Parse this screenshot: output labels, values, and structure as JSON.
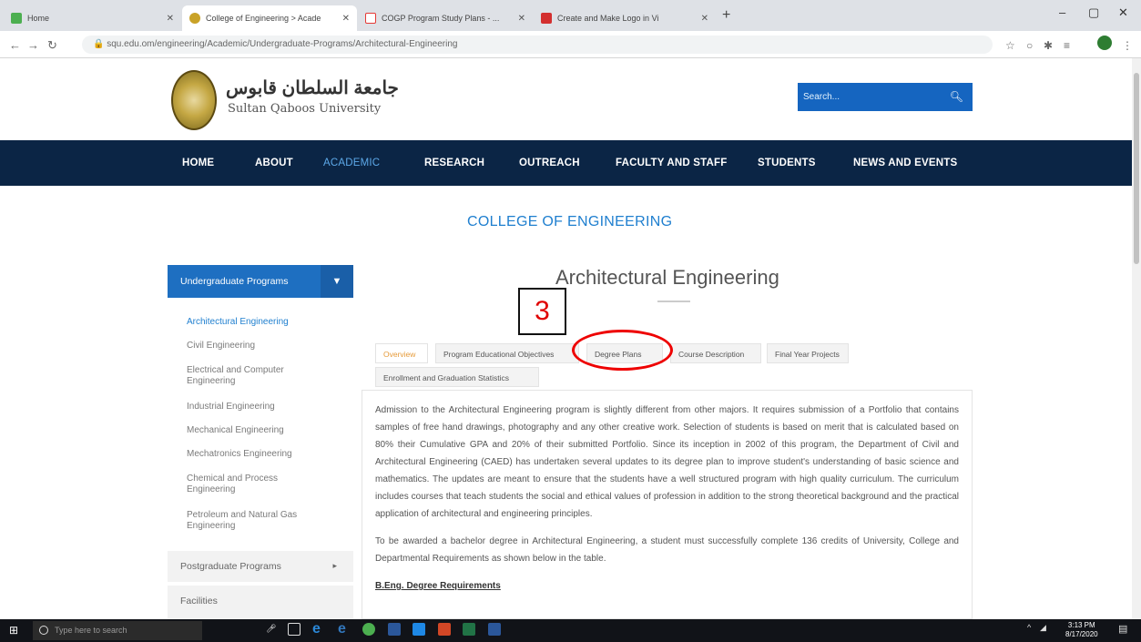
{
  "browser": {
    "tabs": [
      {
        "label": "Home",
        "active": false,
        "color": "#4caf50"
      },
      {
        "label": "College of Engineering > Acade",
        "active": true,
        "color": "#c9a227"
      },
      {
        "label": "COGP Program Study Plans - ...",
        "active": false,
        "color": "#e53935"
      },
      {
        "label": "Create and Make Logo in Vi",
        "active": false,
        "color": "#d32f2f"
      }
    ],
    "new_tab": "+",
    "url": "squ.edu.om/engineering/Academic/Undergraduate-Programs/Architectural-Engineering",
    "window_controls": [
      "–",
      "▢",
      "✕"
    ]
  },
  "site": {
    "logo_arabic": "جامعة السلطان قابوس",
    "logo_english": "Sultan Qaboos University",
    "search_placeholder": "Search...",
    "nav": [
      {
        "label": "HOME",
        "active": false
      },
      {
        "label": "ABOUT",
        "active": false
      },
      {
        "label": "ACADEMIC",
        "active": true
      },
      {
        "label": "RESEARCH",
        "active": false
      },
      {
        "label": "OUTREACH",
        "active": false
      },
      {
        "label": "FACULTY AND STAFF",
        "active": false
      },
      {
        "label": "STUDENTS",
        "active": false
      },
      {
        "label": "NEWS AND EVENTS",
        "active": false
      }
    ],
    "college_title": "COLLEGE OF ENGINEERING",
    "program_title": "Architectural Engineering"
  },
  "sidebar": {
    "header": "Undergraduate Programs",
    "items": [
      "Architectural Engineering",
      "Civil Engineering",
      "Electrical and Computer Engineering",
      "Industrial Engineering",
      "Mechanical Engineering",
      "Mechatronics Engineering",
      "Chemical and Process Engineering",
      "Petroleum and Natural Gas Engineering"
    ],
    "postgraduate": "Postgraduate Programs",
    "facilities": "Facilities"
  },
  "tabs": [
    {
      "label": "Overview",
      "active": true
    },
    {
      "label": "Program Educational Objectives",
      "active": false
    },
    {
      "label": "Degree Plans",
      "active": false
    },
    {
      "label": "Course Description",
      "active": false
    },
    {
      "label": "Final Year Projects",
      "active": false
    },
    {
      "label": "Enrollment and Graduation Statistics",
      "active": false
    }
  ],
  "content": {
    "paragraph1": "Admission to the Architectural Engineering program is slightly different from other majors. It requires submission of a Portfolio that contains samples of free hand drawings, photography and any other creative work. Selection of students is based on merit that is calculated based on 80% their Cumulative GPA and 20% of their submitted Portfolio. Since its inception in 2002 of this program, the Department of Civil and Architectural Engineering (CAED) has undertaken several updates to its degree plan to improve student's understanding of basic science and mathematics. The updates are meant to ensure that the students have a well structured program with high quality curriculum. The curriculum includes courses that teach students the social and ethical values of profession in addition to the strong theoretical background and the practical application of architectural and engineering principles.",
    "paragraph2": "To be awarded a bachelor degree in Architectural Engineering, a student must successfully complete 136 credits of University, College and Departmental Requirements as shown below in the table.",
    "subhead": "B.Eng. Degree Requirements"
  },
  "annotation": {
    "number": "3",
    "color": "#e00000"
  },
  "taskbar": {
    "search_placeholder": "Type here to search",
    "time": "3:13 PM",
    "date": "8/17/2020"
  }
}
